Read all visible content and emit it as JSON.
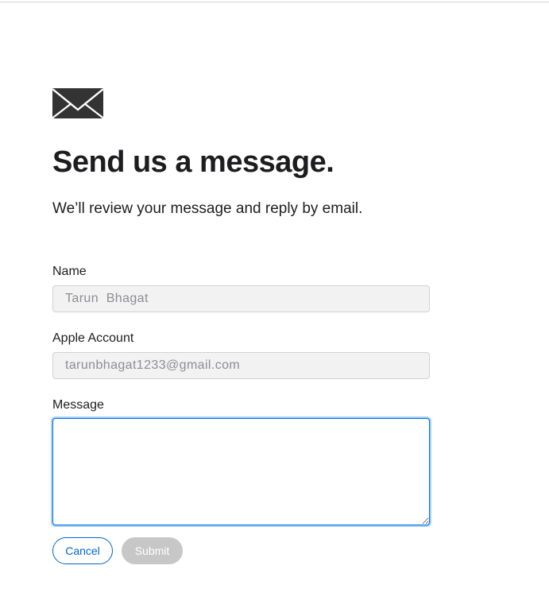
{
  "header": {
    "icon": "envelope-icon",
    "title": "Send us a message.",
    "subtitle": "We’ll review your message and reply by email."
  },
  "form": {
    "name": {
      "label": "Name",
      "value": "Tarun  Bhagat"
    },
    "apple_account": {
      "label": "Apple Account",
      "value": "tarunbhagat1233@gmail.com"
    },
    "message": {
      "label": "Message",
      "value": ""
    }
  },
  "actions": {
    "cancel_label": "Cancel",
    "submit_label": "Submit"
  },
  "colors": {
    "accent": "#0066cc",
    "focus_ring": "#a7d0f5",
    "disabled_button": "#c7c7c7",
    "readonly_field": "#f2f2f2",
    "icon": "#333333"
  }
}
